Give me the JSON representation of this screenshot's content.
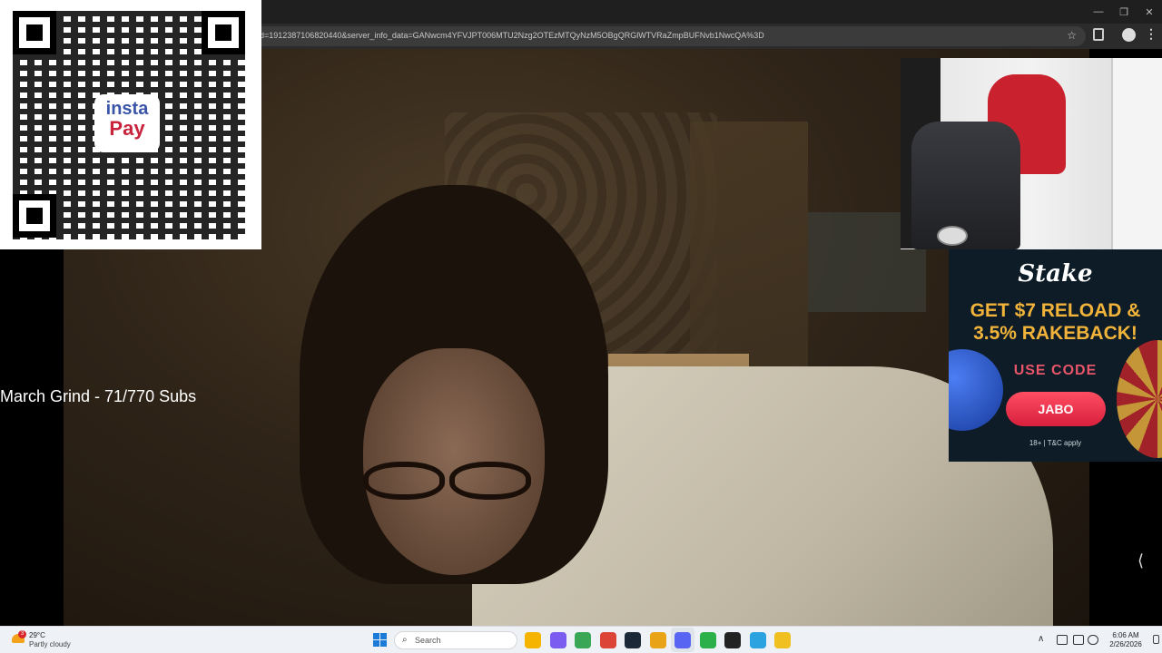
{
  "browser": {
    "url": "d=1912387106820440&server_info_data=GANwcm4YFVJPT006MTU2Nzg2OTEzMTQyNzM5OBgQRGlWTVRaZmpBUFNvb1NwcQA%3D",
    "window_controls": {
      "minimize": "—",
      "maximize": "❐",
      "close": "✕"
    },
    "star_icon": "☆",
    "menu_icon": "⋮"
  },
  "overlay": {
    "grind_text": "March Grind - 71/770 Subs",
    "side_arrow": "⟨"
  },
  "qr": {
    "logo_line1": "insta",
    "logo_line2": "Pay"
  },
  "ad": {
    "brand": "Stake",
    "headline_line1": "GET $7 RELOAD &",
    "headline_line2": "3.5% RAKEBACK!",
    "use_code": "USE CODE",
    "code": "JABO",
    "disclaimer": "18+ | T&C apply"
  },
  "taskbar": {
    "weather": {
      "temp": "29°C",
      "desc": "Partly cloudy",
      "badge": "3"
    },
    "search_placeholder": "Search",
    "search_icon": "⌕",
    "clock": {
      "time": "6:06 AM",
      "date": "2/26/2026"
    },
    "tray_chevron": "∧",
    "apps": [
      {
        "name": "file-explorer-icon",
        "color": "#f4b400"
      },
      {
        "name": "copilot-icon",
        "color": "#7a5cf0"
      },
      {
        "name": "chrome-icon",
        "color": "#3aa757"
      },
      {
        "name": "chrome-profile-icon",
        "color": "#db4437"
      },
      {
        "name": "steam-icon",
        "color": "#1b2838"
      },
      {
        "name": "chrome-alt-icon",
        "color": "#e8a317"
      },
      {
        "name": "discord-icon",
        "color": "#5865f2"
      },
      {
        "name": "android-app-icon",
        "color": "#2bb04a"
      },
      {
        "name": "obs-icon",
        "color": "#222222"
      },
      {
        "name": "telegram-icon",
        "color": "#2aa3e0"
      },
      {
        "name": "winamp-icon",
        "color": "#f0c020"
      }
    ]
  }
}
